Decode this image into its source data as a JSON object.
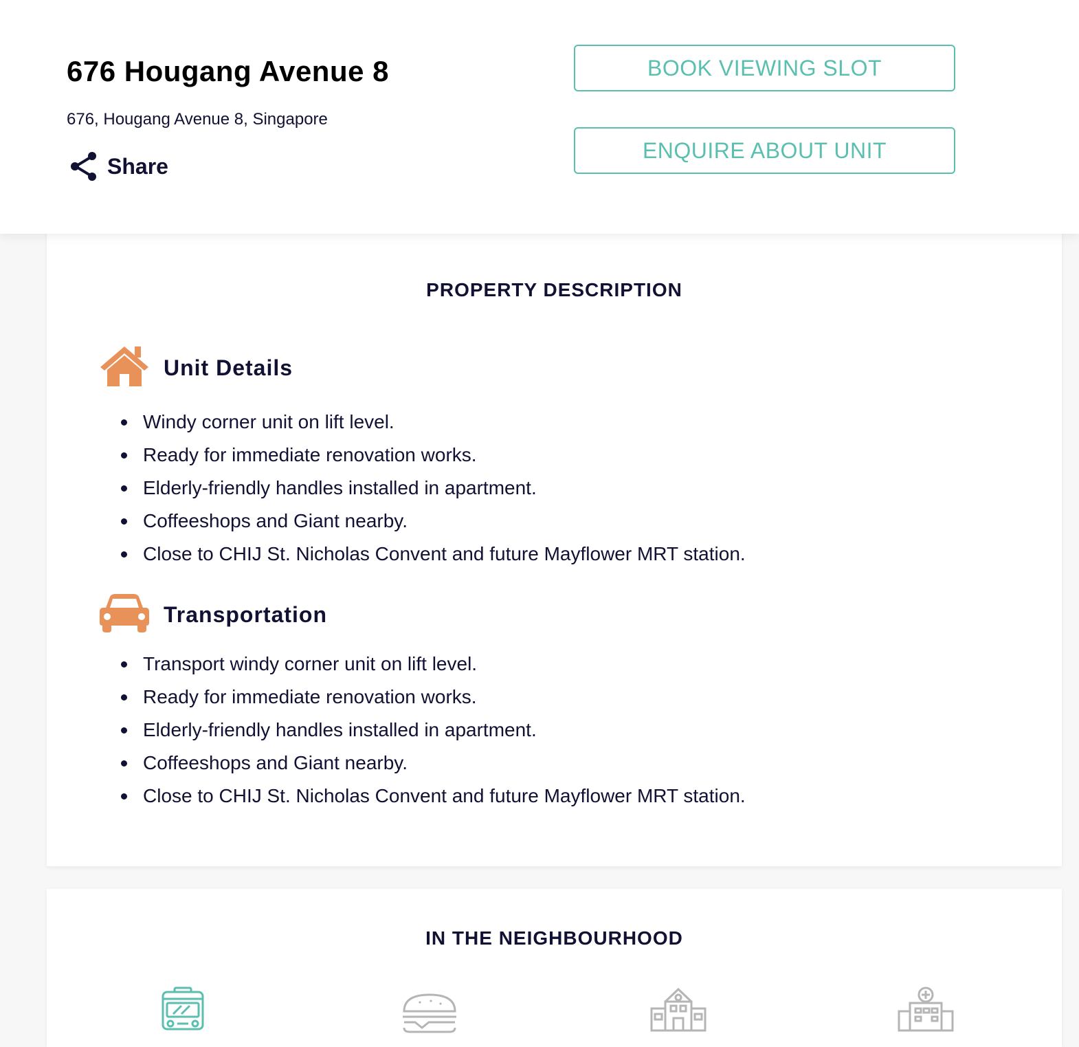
{
  "header": {
    "title": "676 Hougang Avenue 8",
    "address": "676, Hougang Avenue 8, Singapore",
    "share_label": "Share",
    "book_label": "BOOK VIEWING SLOT",
    "enquire_label": "ENQUIRE ABOUT UNIT"
  },
  "description": {
    "title": "PROPERTY DESCRIPTION",
    "sections": [
      {
        "icon": "house-icon",
        "label": "Unit Details",
        "items": [
          "Windy corner unit on lift level.",
          "Ready for immediate renovation works.",
          "Elderly-friendly handles installed in apartment.",
          "Coffeeshops and Giant nearby.",
          "Close to CHIJ St. Nicholas Convent and future Mayflower MRT station."
        ]
      },
      {
        "icon": "car-icon",
        "label": "Transportation",
        "items": [
          "Transport windy corner unit on lift level.",
          "Ready for immediate renovation works.",
          "Elderly-friendly handles installed in apartment.",
          "Coffeeshops and Giant nearby.",
          "Close to CHIJ St. Nicholas Convent and future Mayflower MRT station."
        ]
      }
    ]
  },
  "neighbourhood": {
    "title": "IN THE NEIGHBOURHOOD",
    "icons": [
      "bus-icon",
      "burger-icon",
      "school-icon",
      "hospital-icon"
    ]
  },
  "colors": {
    "accent": "#5bbfb0",
    "icon_orange": "#e8925a",
    "text_dark": "#111133",
    "icon_grey": "#b5b5b5"
  }
}
